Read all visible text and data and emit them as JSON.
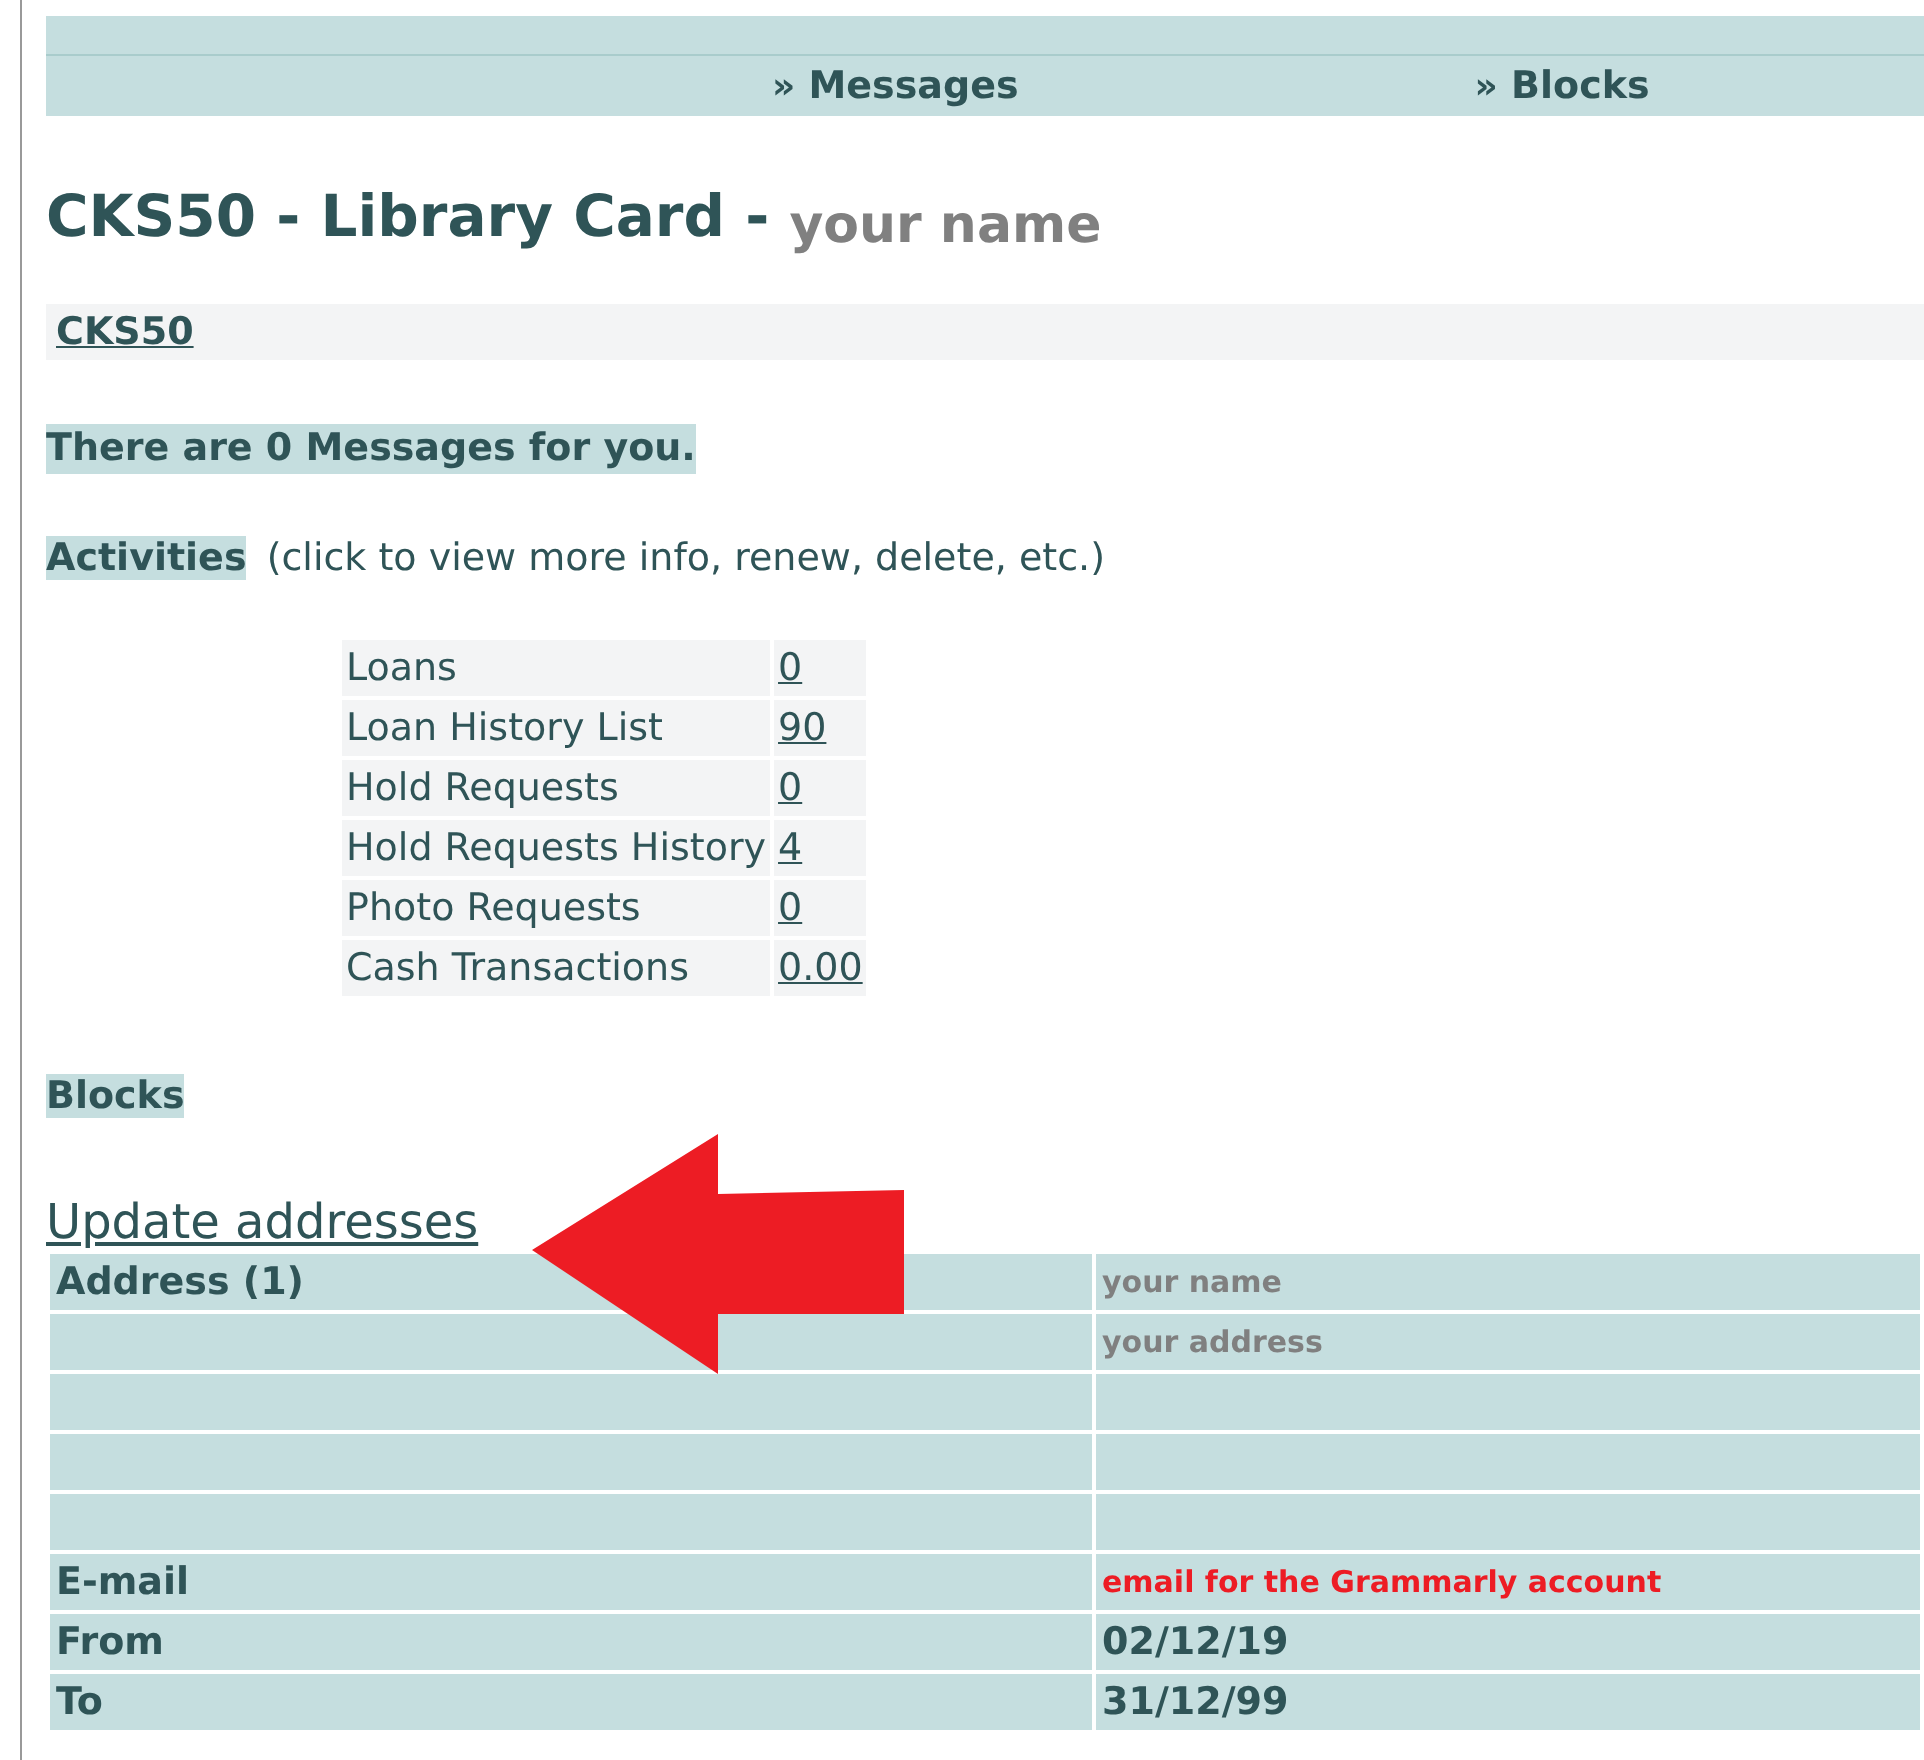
{
  "nav": [
    {
      "glyph": "»",
      "label": "Messages"
    },
    {
      "glyph": "»",
      "label": "Blocks"
    }
  ],
  "title": {
    "main": "CKS50 - Library Card -",
    "name": "your name"
  },
  "card_link": "CKS50",
  "messages_notice": "There are 0 Messages for you.",
  "activities": {
    "heading": "Activities",
    "hint": "(click to view more info, renew, delete, etc.)",
    "rows": [
      {
        "label": "Loans",
        "value": "0"
      },
      {
        "label": "Loan History List",
        "value": "90"
      },
      {
        "label": "Hold Requests",
        "value": "0"
      },
      {
        "label": "Hold Requests History",
        "value": "4"
      },
      {
        "label": "Photo Requests",
        "value": "0"
      },
      {
        "label": "Cash Transactions",
        "value": "0.00"
      }
    ]
  },
  "blocks_heading": "Blocks",
  "update_link": "Update addresses",
  "annotation": {
    "kind": "arrow"
  },
  "address_rows": [
    {
      "label": "Address (1)",
      "value": "your name",
      "kind": "overlay"
    },
    {
      "label": "",
      "value": "your address",
      "kind": "overlay"
    },
    {
      "label": "",
      "value": "",
      "kind": "plain"
    },
    {
      "label": "",
      "value": "",
      "kind": "plain"
    },
    {
      "label": "",
      "value": "",
      "kind": "plain"
    },
    {
      "label": "E-mail",
      "value": "email for the Grammarly account",
      "kind": "alert"
    },
    {
      "label": "From",
      "value": "02/12/19",
      "kind": "plain"
    },
    {
      "label": "To",
      "value": "31/12/99",
      "kind": "plain"
    }
  ]
}
